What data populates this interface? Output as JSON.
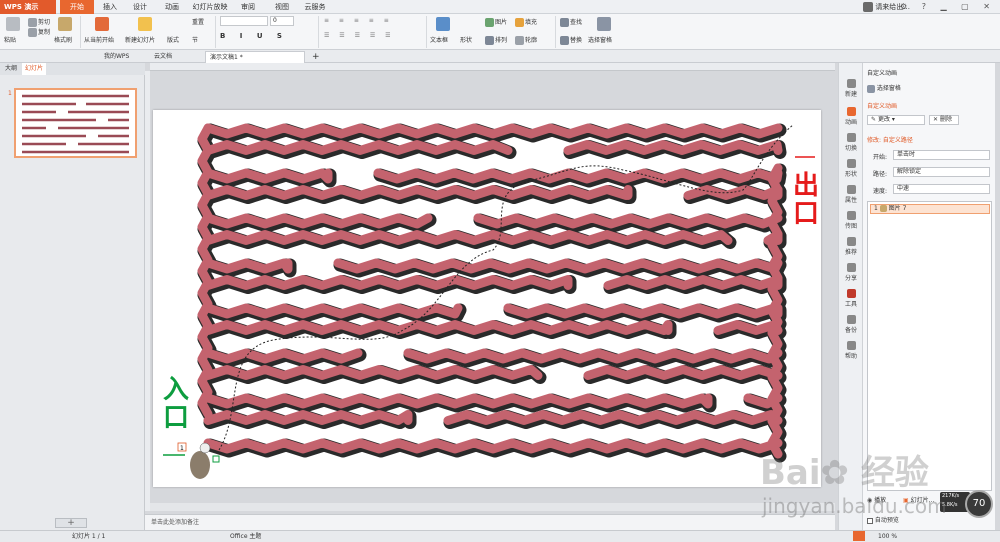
{
  "app": {
    "name": "WPS 演示"
  },
  "menu": [
    "开始",
    "插入",
    "设计",
    "动画",
    "幻灯片放映",
    "审阅",
    "视图",
    "云服务"
  ],
  "user": {
    "name": "请来给出..."
  },
  "ribbon": {
    "paste": "粘贴",
    "cut": "剪切",
    "copy": "复制",
    "format_painter": "格式刷",
    "from_current": "从当前开始",
    "new_slide": "新建幻灯片",
    "layout": "版式",
    "section": "节",
    "reset": "重置",
    "font_size": "0",
    "text_box": "文本框",
    "shape": "形状",
    "picture": "图片",
    "fill": "填充",
    "arrange": "排列",
    "outline": "轮廓",
    "find": "查找",
    "replace": "替换",
    "select_pane": "选择窗格"
  },
  "doctabs": [
    "我的WPS",
    "云文档",
    "演示文稿1 *"
  ],
  "leftpane": {
    "tabs": [
      "大纲",
      "幻灯片"
    ],
    "slide_number": "1"
  },
  "slide": {
    "entrance": "入口",
    "exit": "出口",
    "badge": "1"
  },
  "notes_placeholder": "单击此处添加备注",
  "rside": [
    "新建",
    "动画",
    "切换",
    "形状",
    "属性",
    "传图",
    "推荐",
    "分享",
    "工具",
    "备份",
    "帮助"
  ],
  "rpanel": {
    "title": "自定义动画",
    "select_pane": "选择窗格",
    "section_title": "自定义动画",
    "change_btn": "更改",
    "delete_btn": "删除",
    "modify_label": "修改: 自定义路径",
    "start_label": "开始:",
    "start_value": "单击时",
    "path_label": "路径:",
    "path_value": "解除锁定",
    "speed_label": "速度:",
    "speed_value": "中速",
    "list_item": "图片 7",
    "list_index": "1",
    "play_btn": "播放",
    "slideshow_btn": "幻灯片...",
    "autopreview": "自动预览"
  },
  "status": {
    "slide_count": "幻灯片 1 / 1",
    "theme": "Office 主题",
    "zoom": "100 %",
    "net_up": "217K/s",
    "net_down": "5.8K/s",
    "badge_num": "70"
  },
  "watermark": {
    "text": "jingyan.baidu.com",
    "brand": "经验"
  },
  "colors": {
    "accent": "#e8672f",
    "maze": "#c4636e",
    "entrance": "#0d9d3f",
    "exit": "#e51b1b"
  }
}
